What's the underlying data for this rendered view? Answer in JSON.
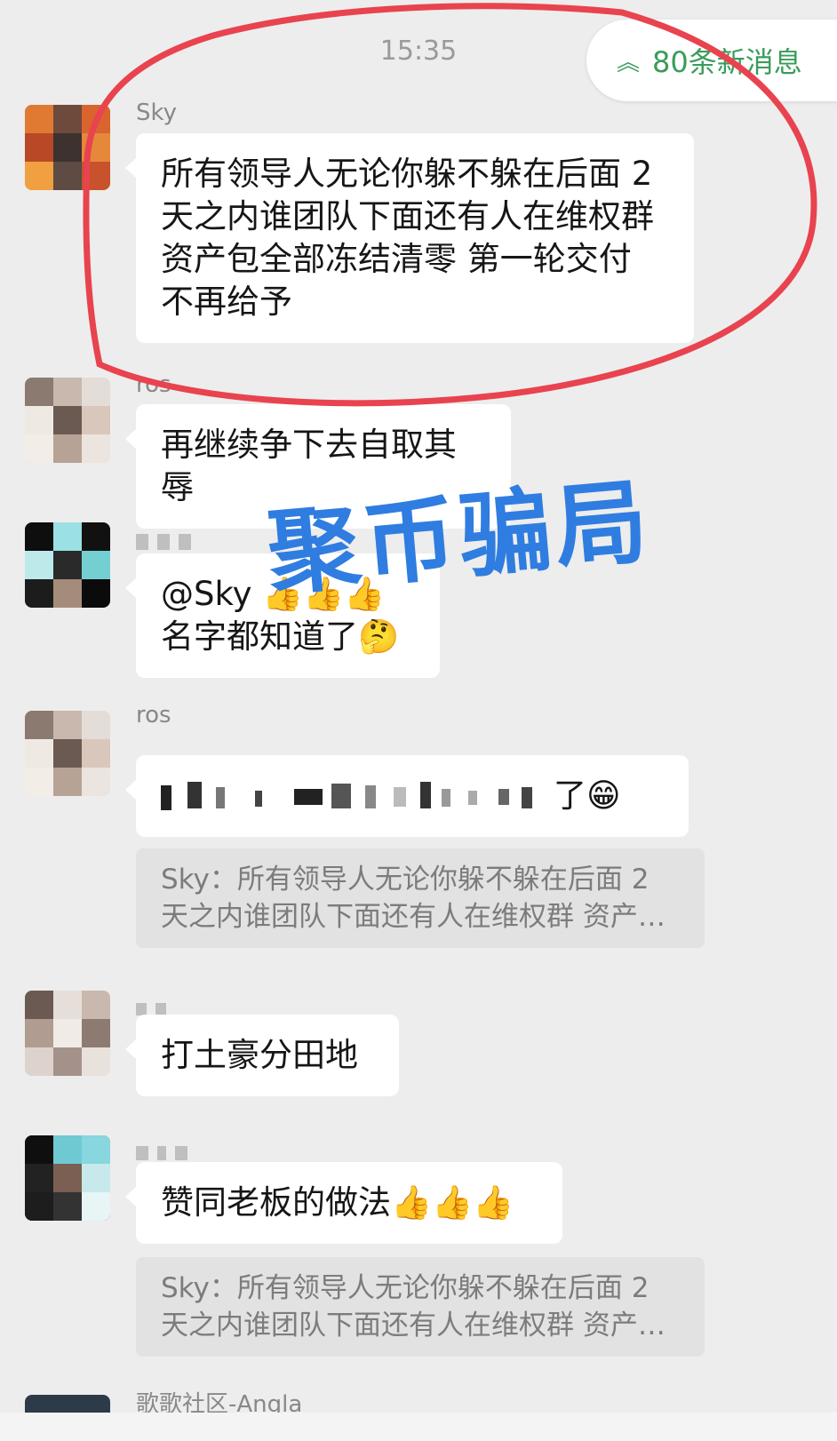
{
  "chat": {
    "timestamp": "15:35",
    "new_messages_label": "80条新消息"
  },
  "watermark": "聚币骗局",
  "messages": [
    {
      "sender": "Sky",
      "text_lines": [
        "所有领导人无论你躲不躲在后面 2",
        "天之内谁团队下面还有人在维权群",
        "资产包全部冻结清零 第一轮交付",
        "不再给予"
      ]
    },
    {
      "sender": "ros",
      "text": "再继续争下去自取其辱"
    },
    {
      "sender": "",
      "line1": "@Sky 👍👍👍",
      "line2": "名字都知道了🤔"
    },
    {
      "sender": "ros",
      "text": "了😁",
      "quote_lines": [
        "Sky：所有领导人无论你躲不躲在后面  2",
        "天之内谁团队下面还有人在维权群 资产…"
      ]
    },
    {
      "sender": "",
      "text": "打土豪分田地"
    },
    {
      "sender": "",
      "text": "赞同老板的做法👍👍👍",
      "quote_lines": [
        "Sky：所有领导人无论你躲不躲在后面  2",
        "天之内谁团队下面还有人在维权群 资产…"
      ]
    },
    {
      "sender": "歌歌社区-Angla"
    }
  ],
  "colors": {
    "accent_green": "#3a9c5a",
    "annotation_red": "#e8434f",
    "watermark_blue": "#2f7de0"
  }
}
